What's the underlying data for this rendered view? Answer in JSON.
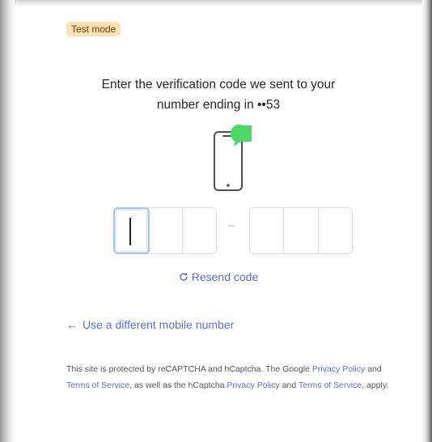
{
  "badge": {
    "label": "Test mode"
  },
  "heading": {
    "line1": "Enter the verification code we sent to your",
    "line2": "number ending in ••53"
  },
  "code": {
    "group1": [
      "",
      "",
      ""
    ],
    "group2": [
      "",
      "",
      ""
    ]
  },
  "resend": {
    "label": "Resend code",
    "icon": "refresh-icon"
  },
  "other_number": {
    "label": "Use a different mobile number",
    "icon": "arrow-left-icon"
  },
  "legal": {
    "part1": "This site is protected by reCAPTCHA and hCaptcha. The Google ",
    "link1": "Privacy Policy",
    "part2": " and ",
    "link2": "Terms of Service",
    "part3": ", as well as the hCaptcha ",
    "link3": "Privacy Policy",
    "part4": " and ",
    "link4": "Terms of Service",
    "part5": ", apply."
  },
  "colors": {
    "accent": "#5b6fd6",
    "badge_bg": "#fde1b5",
    "bubble_green": "#4cd964"
  }
}
